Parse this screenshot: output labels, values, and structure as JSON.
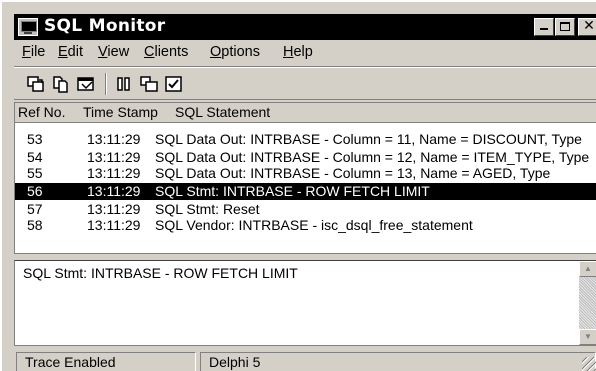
{
  "window": {
    "title": "SQL Monitor",
    "icon": "monitor-icon",
    "controls": [
      "minimize-icon",
      "maximize-icon",
      "close-icon"
    ]
  },
  "menu": {
    "file": "File",
    "edit": "Edit",
    "view": "View",
    "clients": "Clients",
    "options": "Options",
    "help": "Help"
  },
  "toolbar": {
    "buttons": [
      "save-log-icon",
      "copy-icon",
      "print-icon",
      "pause-icon",
      "clear-icon",
      "options-icon"
    ]
  },
  "list": {
    "columns": [
      "Ref No.",
      "Time Stamp",
      "SQL Statement"
    ],
    "rows": [
      {
        "ref": "53",
        "time": "13:11:29",
        "statement": "SQL Data Out: INTRBASE - Column = 11, Name = DISCOUNT, Type"
      },
      {
        "ref": "54",
        "time": "13:11:29",
        "statement": "SQL Data Out: INTRBASE - Column = 12, Name = ITEM_TYPE, Type"
      },
      {
        "ref": "55",
        "time": "13:11:29",
        "statement": "SQL Data Out: INTRBASE - Column = 13, Name =  AGED, Type"
      },
      {
        "ref": "56",
        "time": "13:11:29",
        "statement": "SQL Stmt: INTRBASE - ROW FETCH LIMIT"
      },
      {
        "ref": "57",
        "time": "13:11:29",
        "statement": "SQL Stmt: Reset"
      },
      {
        "ref": "58",
        "time": "13:11:29",
        "statement": "SQL Vendor: INTRBASE - isc_dsql_free_statement"
      }
    ],
    "selected_index": 3
  },
  "detail": {
    "text": "SQL  Stmt: INTRBASE - ROW FETCH LIMIT"
  },
  "status": {
    "trace": "Trace Enabled",
    "client": "Delphi 5"
  },
  "colors": {
    "face": "#d4d0c8",
    "title_bg": "#000000",
    "selection_bg": "#000000"
  }
}
